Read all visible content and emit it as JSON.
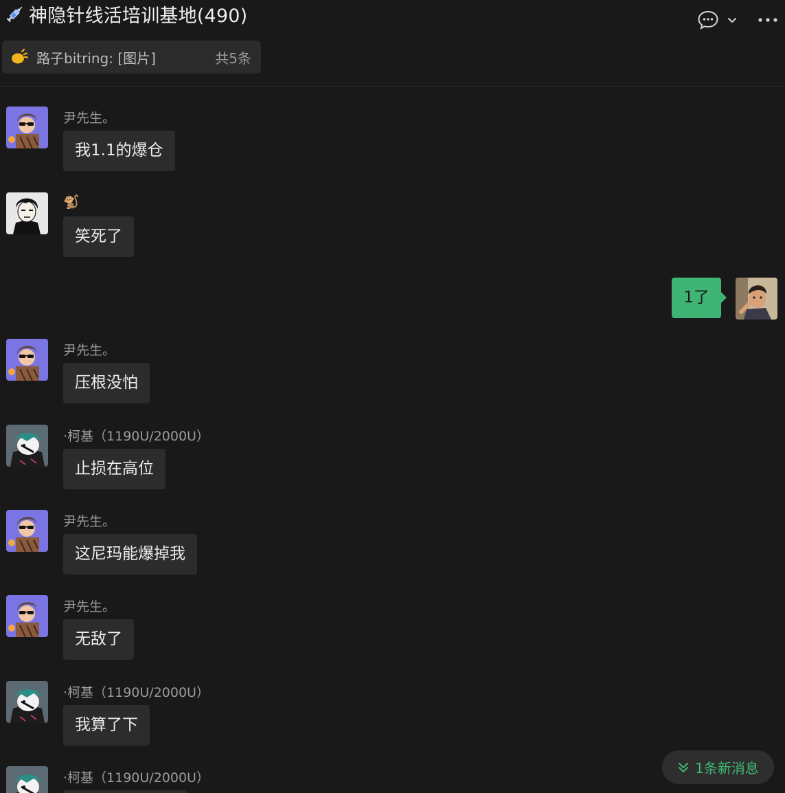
{
  "header": {
    "title": "神隐针线活培训基地(490)",
    "title_icon": "syringe-icon",
    "actions": [
      {
        "icon": "chat-bubble-icon"
      },
      {
        "icon": "chevron-down-icon"
      },
      {
        "icon": "more-icon"
      }
    ]
  },
  "pinned": {
    "icon": "megaphone-icon",
    "text": "路子bitring: [图片]",
    "count": "共5条"
  },
  "messages": [
    {
      "sender": "尹先生。",
      "text": "我1.1的爆仓",
      "avatar": "avatar-yin"
    },
    {
      "sender": "🐒",
      "text": "笑死了",
      "avatar": "avatar-monkey"
    },
    {
      "sender": "",
      "text": "1了",
      "avatar": "avatar-self",
      "mine": true
    },
    {
      "sender": "尹先生。",
      "text": "压根没怕",
      "avatar": "avatar-yin"
    },
    {
      "sender": "·柯基（1190U/2000U）",
      "text": "止损在高位",
      "avatar": "avatar-keji"
    },
    {
      "sender": "尹先生。",
      "text": "这尼玛能爆掉我",
      "avatar": "avatar-yin"
    },
    {
      "sender": "尹先生。",
      "text": "无敌了",
      "avatar": "avatar-yin"
    },
    {
      "sender": "·柯基（1190U/2000U）",
      "text": "我算了下",
      "avatar": "avatar-keji"
    },
    {
      "sender": "·柯基（1190U/2000U）",
      "text": "",
      "avatar": "avatar-keji"
    }
  ],
  "new_message_button": {
    "label": "1条新消息",
    "icon": "double-chevron-down-icon",
    "color": "#3fb874"
  },
  "colors": {
    "background": "#191919",
    "bubble_other": "#2c2c2c",
    "bubble_mine": "#3eb575"
  }
}
